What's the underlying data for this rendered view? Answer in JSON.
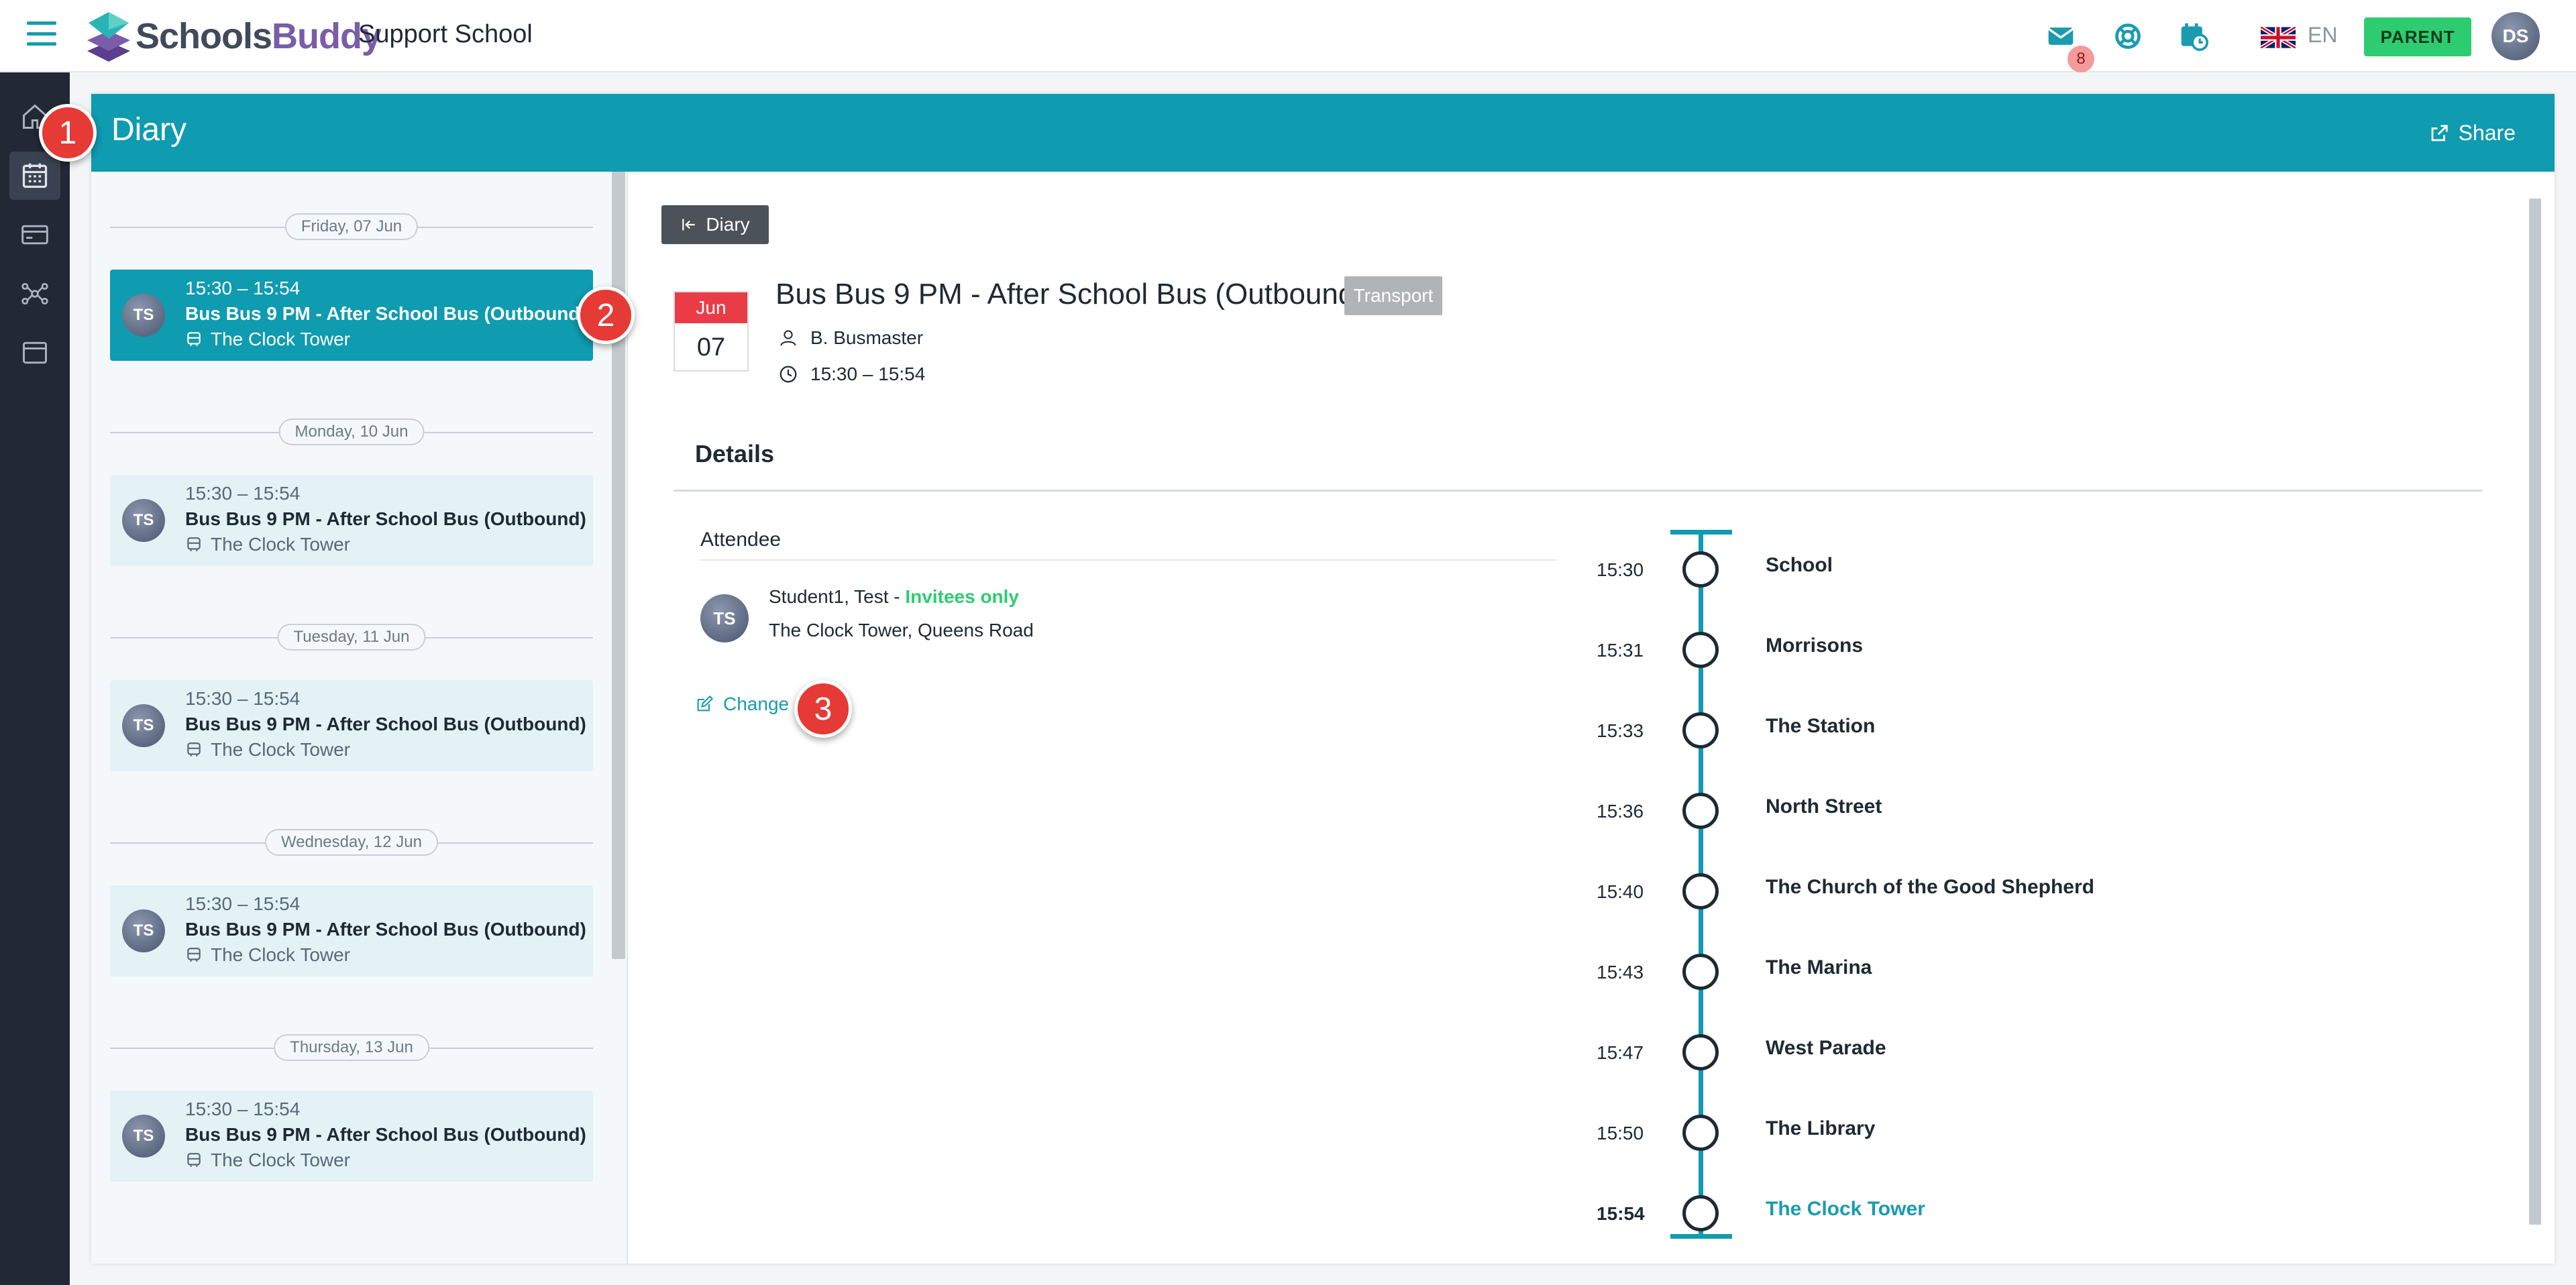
{
  "app": {
    "brand_part1": "Schools",
    "brand_part2": "Buddy",
    "school_name": "Support School",
    "message_badge": "8",
    "language": "EN",
    "role": "PARENT",
    "user_initials": "DS",
    "colors": {
      "accent": "#0f9bb0",
      "success": "#2ecc71",
      "sidebar": "#222834",
      "danger": "#ea3c47"
    }
  },
  "sidebar": {
    "items": [
      {
        "icon": "home-icon"
      },
      {
        "icon": "calendar-icon",
        "active": true
      },
      {
        "icon": "payment-card-icon"
      },
      {
        "icon": "network-icon"
      },
      {
        "icon": "window-icon"
      }
    ]
  },
  "page": {
    "title": "Diary",
    "share_label": "Share"
  },
  "diary_list": {
    "groups": [
      {
        "date": "Friday, 07 Jun",
        "event": {
          "initials": "TS",
          "time": "15:30 – 15:54",
          "title": "Bus Bus 9 PM - After School Bus (Outbound)",
          "location": "The Clock Tower",
          "selected": true
        }
      },
      {
        "date": "Monday, 10 Jun",
        "event": {
          "initials": "TS",
          "time": "15:30 – 15:54",
          "title": "Bus Bus 9 PM - After School Bus (Outbound)",
          "location": "The Clock Tower"
        }
      },
      {
        "date": "Tuesday, 11 Jun",
        "event": {
          "initials": "TS",
          "time": "15:30 – 15:54",
          "title": "Bus Bus 9 PM - After School Bus (Outbound)",
          "location": "The Clock Tower"
        }
      },
      {
        "date": "Wednesday, 12 Jun",
        "event": {
          "initials": "TS",
          "time": "15:30 – 15:54",
          "title": "Bus Bus 9 PM - After School Bus (Outbound)",
          "location": "The Clock Tower"
        }
      },
      {
        "date": "Thursday, 13 Jun",
        "event": {
          "initials": "TS",
          "time": "15:30 – 15:54",
          "title": "Bus Bus 9 PM - After School Bus (Outbound)",
          "location": "The Clock Tower"
        }
      }
    ]
  },
  "callouts": [
    "1",
    "2",
    "3"
  ],
  "event_detail": {
    "back_label": "Diary",
    "month": "Jun",
    "day": "07",
    "title": "Bus Bus 9 PM - After School Bus (Outbound)",
    "tag": "Transport",
    "organiser": "B. Busmaster",
    "time": "15:30 – 15:54",
    "details_heading": "Details",
    "attendee_heading": "Attendee",
    "attendee": {
      "initials": "TS",
      "name": "Student1, Test - ",
      "visibility": "Invitees only",
      "address": "The Clock Tower, Queens Road"
    },
    "change_label": "Change",
    "route": [
      {
        "time": "15:30",
        "stop": "School"
      },
      {
        "time": "15:31",
        "stop": "Morrisons"
      },
      {
        "time": "15:33",
        "stop": "The Station"
      },
      {
        "time": "15:36",
        "stop": "North Street"
      },
      {
        "time": "15:40",
        "stop": "The Church of the Good Shepherd"
      },
      {
        "time": "15:43",
        "stop": "The Marina"
      },
      {
        "time": "15:47",
        "stop": "West Parade"
      },
      {
        "time": "15:50",
        "stop": "The Library"
      },
      {
        "time": "15:54",
        "stop": "The Clock Tower"
      }
    ]
  }
}
